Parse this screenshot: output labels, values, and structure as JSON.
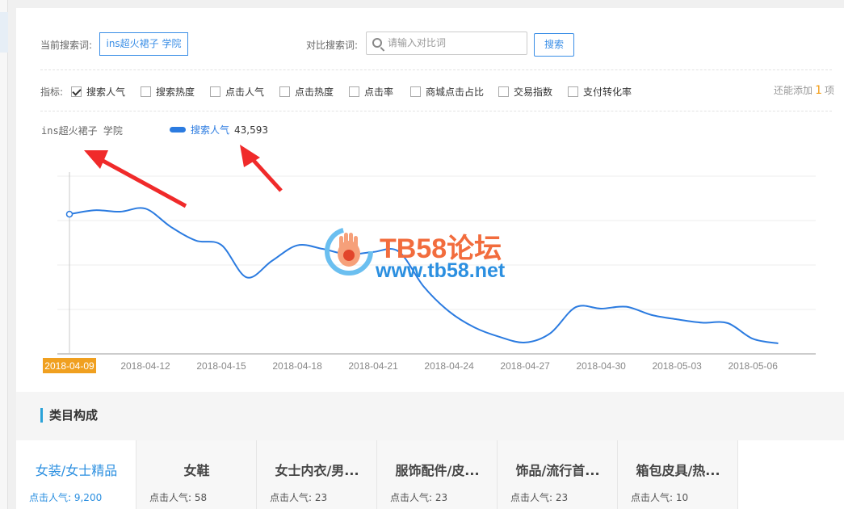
{
  "search": {
    "current_label": "当前搜索词:",
    "current_keyword": "ins超火裙子 学院",
    "compare_label": "对比搜索词:",
    "compare_placeholder": "请输入对比词",
    "search_button": "搜索"
  },
  "metrics": {
    "label": "指标:",
    "items": [
      {
        "label": "搜索人气",
        "checked": true
      },
      {
        "label": "搜索热度",
        "checked": false
      },
      {
        "label": "点击人气",
        "checked": false
      },
      {
        "label": "点击热度",
        "checked": false
      },
      {
        "label": "点击率",
        "checked": false
      },
      {
        "label": "商城点击占比",
        "checked": false
      },
      {
        "label": "交易指数",
        "checked": false
      },
      {
        "label": "支付转化率",
        "checked": false
      }
    ],
    "remaining_prefix": "还能添加",
    "remaining_count": "1",
    "remaining_suffix": "项"
  },
  "legend": {
    "keyword": "ins超火裙子 学院",
    "series_name": "搜索人气",
    "series_value": "43,593"
  },
  "chart_data": {
    "type": "line",
    "x": [
      "2018-04-09",
      "2018-04-10",
      "2018-04-11",
      "2018-04-12",
      "2018-04-13",
      "2018-04-14",
      "2018-04-15",
      "2018-04-16",
      "2018-04-17",
      "2018-04-18",
      "2018-04-19",
      "2018-04-20",
      "2018-04-21",
      "2018-04-22",
      "2018-04-23",
      "2018-04-24",
      "2018-04-25",
      "2018-04-26",
      "2018-04-27",
      "2018-04-28",
      "2018-04-29",
      "2018-04-30",
      "2018-05-01",
      "2018-05-02",
      "2018-05-03",
      "2018-05-04",
      "2018-05-05",
      "2018-05-06",
      "2018-05-07"
    ],
    "xticks": [
      "2018-04-09",
      "2018-04-12",
      "2018-04-15",
      "2018-04-18",
      "2018-04-21",
      "2018-04-24",
      "2018-04-27",
      "2018-04-30",
      "2018-05-03",
      "2018-05-06"
    ],
    "highlighted_x": "2018-04-09",
    "series": [
      {
        "name": "搜索人气",
        "color": "#2b7be0",
        "values": [
          43593,
          45500,
          44800,
          46300,
          37500,
          30800,
          28700,
          13000,
          21000,
          28500,
          26800,
          24100,
          25300,
          25600,
          8500,
          -3500,
          -11200,
          -15800,
          -18500,
          -14000,
          -1400,
          -2100,
          -1200,
          -5200,
          -7300,
          -8900,
          -9100,
          -16700,
          -18900
        ]
      }
    ],
    "ylim": [
      -24000,
      62000
    ],
    "gridlines": 4,
    "xlabel": "",
    "ylabel": ""
  },
  "watermark": {
    "title": "TB58论坛",
    "url": "www.tb58.net"
  },
  "category": {
    "title": "类目构成",
    "tabs": [
      {
        "name": "女装/女士精品",
        "stat": "点击人气: 9,200",
        "active": true
      },
      {
        "name": "女鞋",
        "stat": "点击人气: 58",
        "active": false
      },
      {
        "name": "女士内衣/男...",
        "stat": "点击人气: 23",
        "active": false
      },
      {
        "name": "服饰配件/皮...",
        "stat": "点击人气: 23",
        "active": false
      },
      {
        "name": "饰品/流行首...",
        "stat": "点击人气: 23",
        "active": false
      },
      {
        "name": "箱包皮具/热...",
        "stat": "点击人气: 10",
        "active": false
      }
    ]
  }
}
